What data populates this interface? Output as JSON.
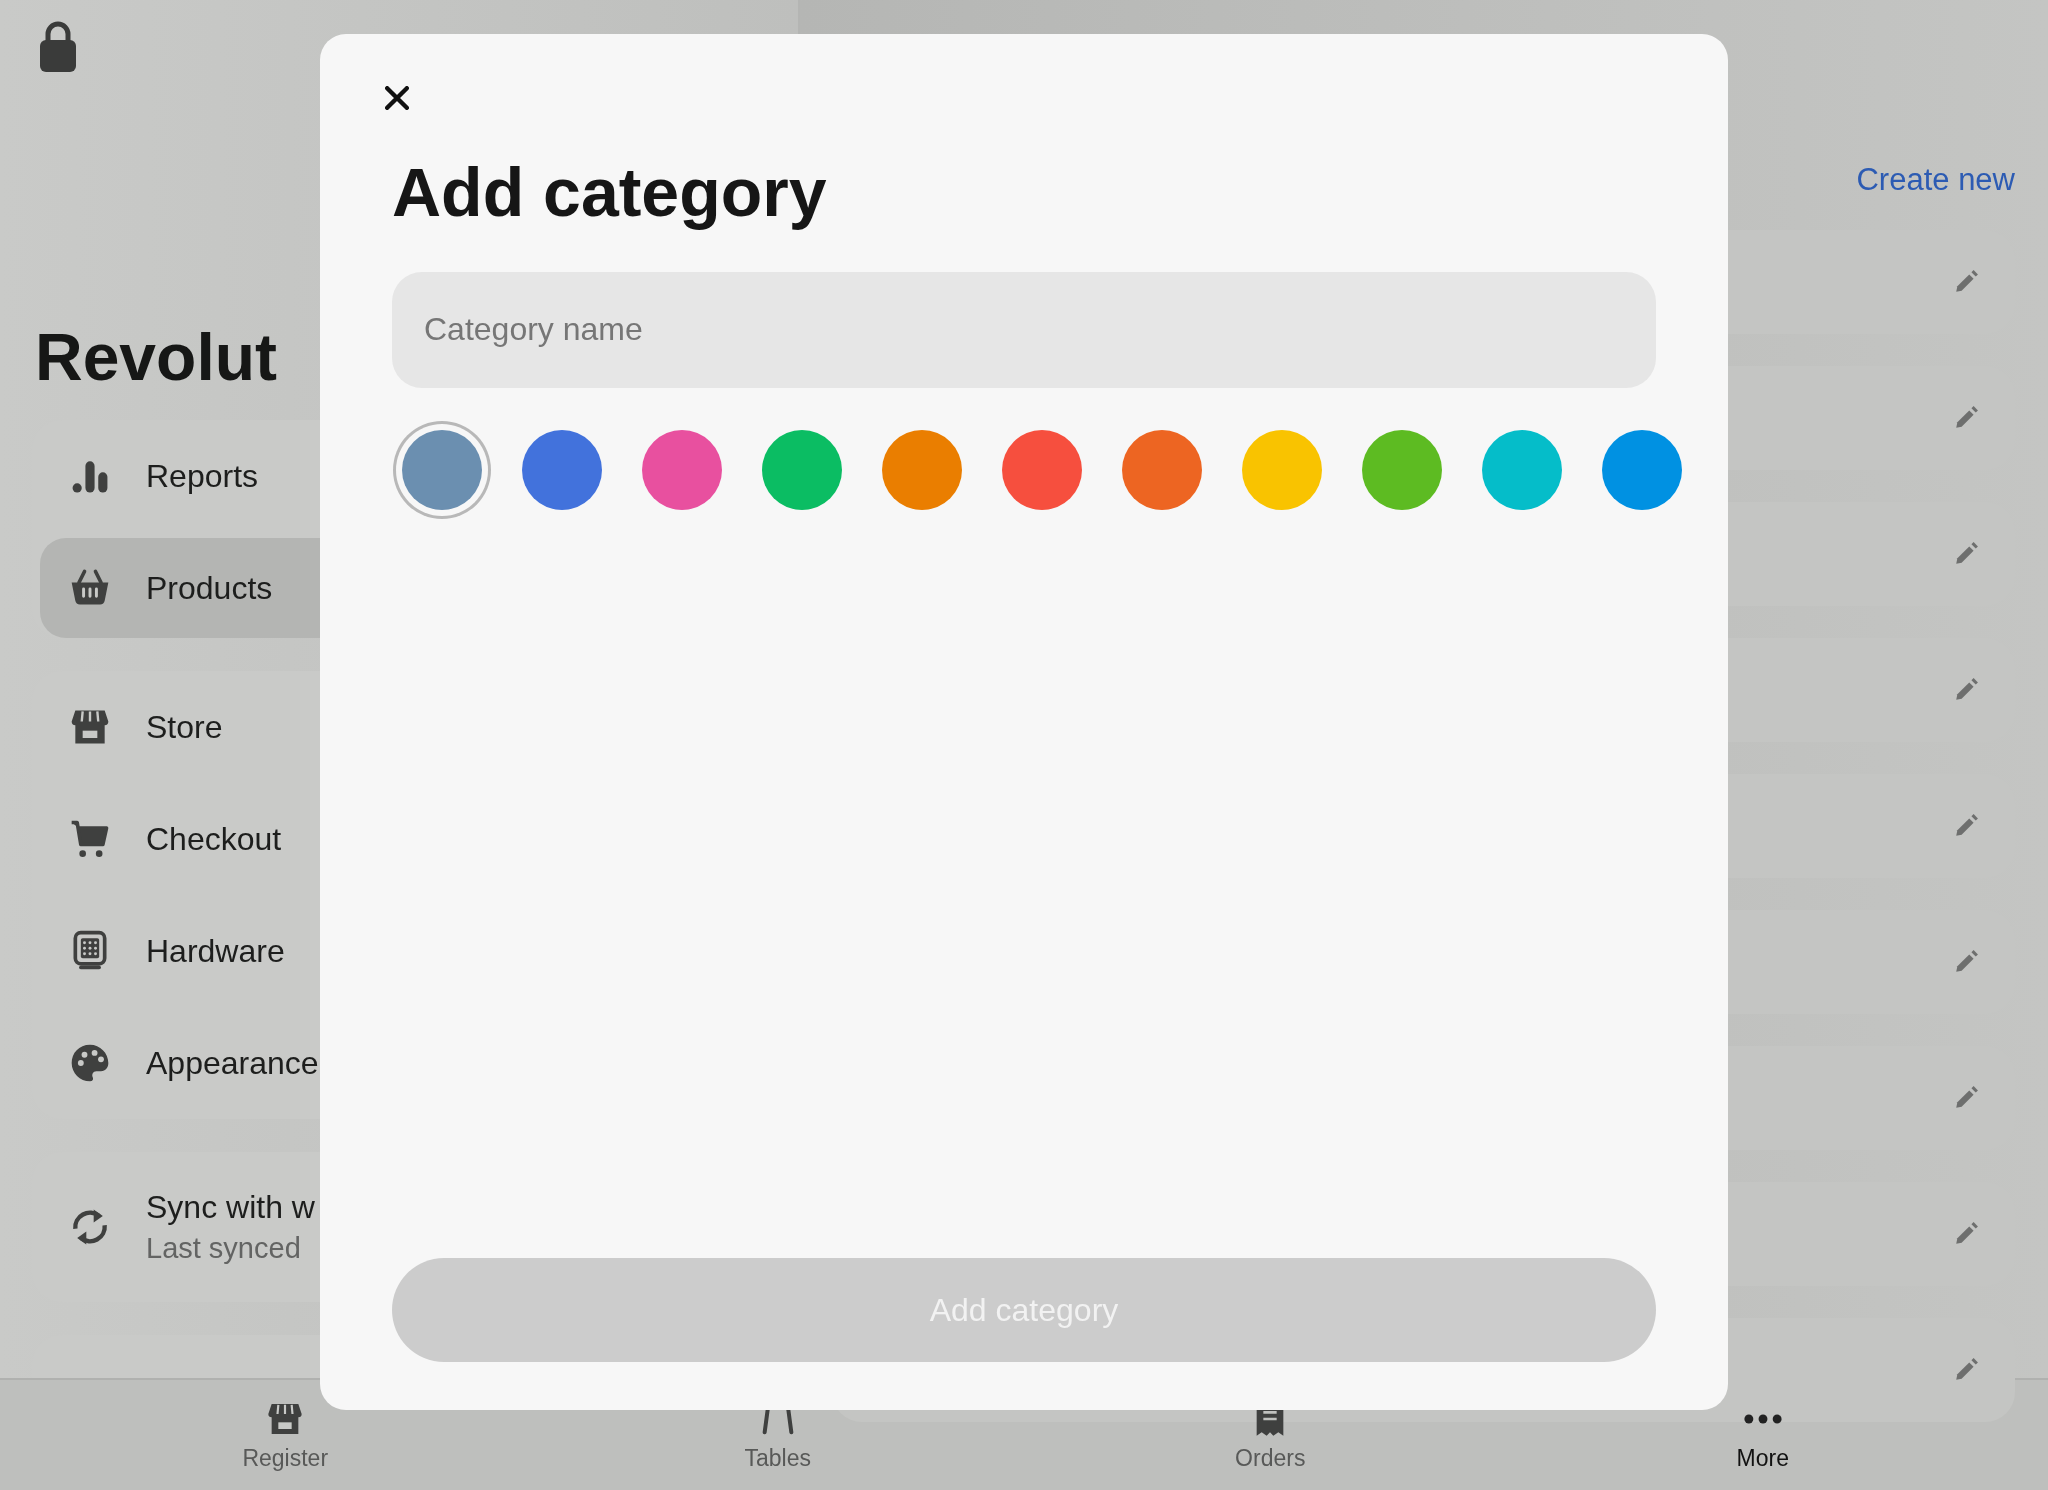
{
  "sidebar": {
    "title": "Revolut",
    "groups": [
      {
        "items": [
          {
            "kind": "reports",
            "label": "Reports",
            "selected": false
          },
          {
            "kind": "products",
            "label": "Products",
            "selected": true
          }
        ]
      },
      {
        "items": [
          {
            "kind": "store",
            "label": "Store",
            "selected": false
          },
          {
            "kind": "checkout",
            "label": "Checkout",
            "selected": false
          },
          {
            "kind": "hardware",
            "label": "Hardware",
            "selected": false
          },
          {
            "kind": "appearance",
            "label": "Appearance",
            "selected": false
          }
        ]
      },
      {
        "items": [
          {
            "kind": "sync",
            "label": "Sync with w",
            "sublabel": "Last synced",
            "selected": false
          }
        ]
      }
    ]
  },
  "catalog": {
    "create_link": "Create new"
  },
  "tab_bar": [
    {
      "kind": "register",
      "label": "Register",
      "selected": false
    },
    {
      "kind": "tables",
      "label": "Tables",
      "selected": false
    },
    {
      "kind": "orders",
      "label": "Orders",
      "selected": false
    },
    {
      "kind": "more",
      "label": "More",
      "selected": true
    }
  ],
  "modal": {
    "title": "Add category",
    "name_field": {
      "placeholder": "Category name"
    },
    "colors": [
      {
        "color": "#6b8fb0",
        "selected": true
      },
      {
        "color": "#4272dc",
        "selected": false
      },
      {
        "color": "#e8509f",
        "selected": false
      },
      {
        "color": "#0bbd63",
        "selected": false
      },
      {
        "color": "#ea7e00",
        "selected": false
      },
      {
        "color": "#f64f3e",
        "selected": false
      },
      {
        "color": "#ed6522",
        "selected": false
      },
      {
        "color": "#f9c300",
        "selected": false
      },
      {
        "color": "#5dbb22",
        "selected": false
      },
      {
        "color": "#05bdc9",
        "selected": false
      },
      {
        "color": "#0091e2",
        "selected": false
      }
    ],
    "submit": {
      "label": "Add category",
      "disabled": true
    }
  }
}
